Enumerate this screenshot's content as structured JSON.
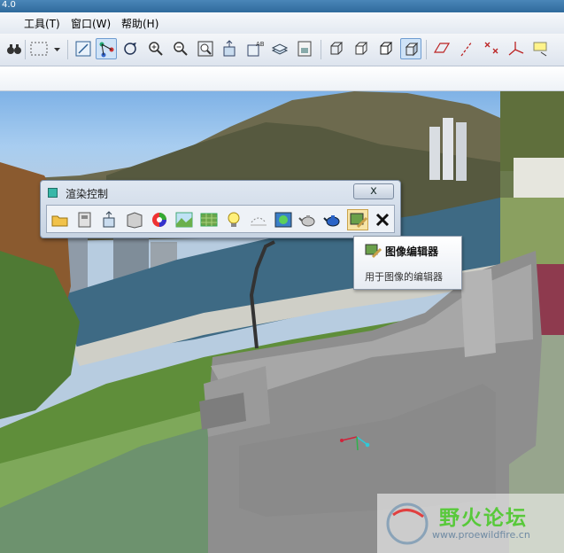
{
  "window": {
    "title_fragment": "4.0"
  },
  "menu": {
    "items": [
      "工具(T)",
      "窗口(W)",
      "帮助(H)"
    ]
  },
  "toolbar": {
    "buttons": [
      {
        "name": "binoculars-icon",
        "active": false
      },
      {
        "name": "selection-box-icon",
        "active": false
      },
      {
        "name": "dropdown-arrow-icon",
        "active": false
      },
      {
        "name": "refit-view-icon",
        "active": false
      },
      {
        "name": "spin-center-icon",
        "active": true
      },
      {
        "name": "reorient-icon",
        "active": false
      },
      {
        "name": "zoom-in-icon",
        "active": false
      },
      {
        "name": "zoom-out-icon",
        "active": false
      },
      {
        "name": "zoom-window-icon",
        "active": false
      },
      {
        "name": "view-manager-icon",
        "active": false
      },
      {
        "name": "saved-views-icon",
        "active": false
      },
      {
        "name": "layers-icon",
        "active": false
      },
      {
        "name": "save-view-icon",
        "active": false
      },
      {
        "name": "wireframe-icon",
        "active": false
      },
      {
        "name": "hidden-line-icon",
        "active": false
      },
      {
        "name": "no-hidden-icon",
        "active": false
      },
      {
        "name": "shading-icon",
        "active": true
      },
      {
        "name": "datum-plane-icon",
        "active": false
      },
      {
        "name": "datum-axis-icon",
        "active": false
      },
      {
        "name": "datum-point-icon",
        "active": false
      },
      {
        "name": "coordinate-system-icon",
        "active": false
      },
      {
        "name": "annotation-icon",
        "active": false
      }
    ]
  },
  "render_panel": {
    "title": "渲染控制",
    "close_label": "x",
    "tools": [
      {
        "name": "open-folder-icon",
        "active": false
      },
      {
        "name": "scene-icon",
        "active": false
      },
      {
        "name": "import-icon",
        "active": false
      },
      {
        "name": "room-icon",
        "active": false
      },
      {
        "name": "color-wheel-icon",
        "active": false
      },
      {
        "name": "landscape-icon",
        "active": false
      },
      {
        "name": "texture-map-icon",
        "active": false
      },
      {
        "name": "light-bulb-icon",
        "active": false
      },
      {
        "name": "fog-icon",
        "active": false
      },
      {
        "name": "effects-icon",
        "active": false
      },
      {
        "name": "teapot-icon",
        "active": false
      },
      {
        "name": "blue-teapot-icon",
        "active": false
      },
      {
        "name": "image-editor-icon",
        "active": true
      },
      {
        "name": "close-x-icon",
        "active": false
      }
    ]
  },
  "tooltip": {
    "title": "图像编辑器",
    "description": "用于图像的编辑器"
  },
  "watermark": {
    "text": "野火论坛",
    "url": "www.proewildfire.cn"
  }
}
